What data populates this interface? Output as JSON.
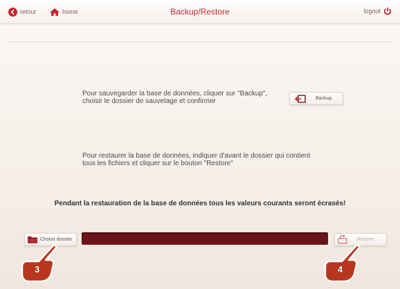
{
  "header": {
    "back_label": "retour",
    "home_label": "home",
    "title": "Backup/Restore",
    "logout_label": "logout"
  },
  "backup": {
    "text_line1": "Pour sauvegarder la base de données, cliquer sur \"Backup\",",
    "text_line2": "choisir le dossier de sauvetage et confirmer",
    "button_label": "Backup"
  },
  "restore": {
    "text_line1": "Pour restaurer la base de données, indiquer d'avant le dossier qui contient",
    "text_line2": "tous les fichiers et cliquer sur le bouton \"Restore\"",
    "warning": "Pendant la restauration de la base de données tous les valeurs courants seront écrasés!",
    "choose_label": "Choisir dossier",
    "path_value": "",
    "button_label": "Restore"
  },
  "annotations": {
    "marker_3": "3",
    "marker_4": "4"
  },
  "colors": {
    "accent_red": "#c4272d",
    "path_bar": "#6b1419",
    "marker_fill": "#b8361e"
  },
  "icons": [
    "back-arrow-icon",
    "home-icon",
    "power-icon",
    "backup-icon",
    "folder-icon",
    "restore-icon",
    "hand-pointer-icon"
  ]
}
